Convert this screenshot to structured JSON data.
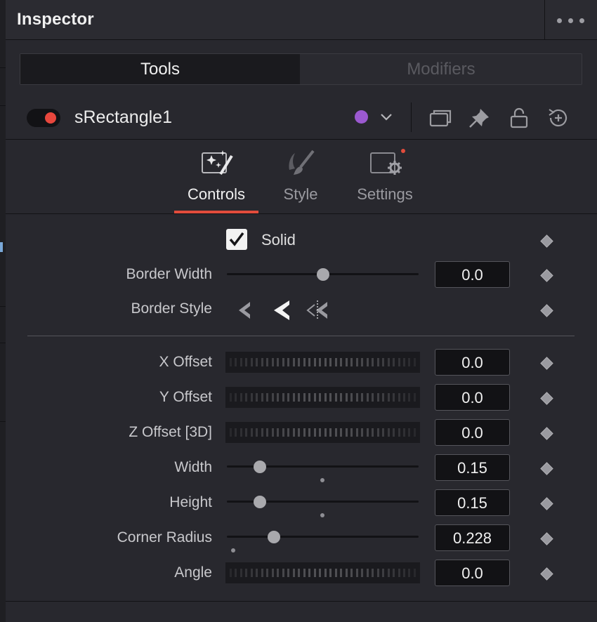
{
  "window": {
    "title": "Inspector",
    "more_icon": "ellipsis-icon"
  },
  "tabs": {
    "tools": "Tools",
    "modifiers": "Modifiers",
    "active": "Tools"
  },
  "node": {
    "name": "sRectangle1",
    "enabled": true,
    "toggle_color": "#e8473d",
    "color_swatch": "#9b59d0",
    "icons": [
      "copy-icon",
      "pin-icon",
      "lock-icon",
      "reset-icon"
    ]
  },
  "subtabs": [
    {
      "label": "Controls",
      "icon": "magic-wand-icon",
      "active": true
    },
    {
      "label": "Style",
      "icon": "brush-icon",
      "active": false
    },
    {
      "label": "Settings",
      "icon": "settings-gear-icon",
      "active": false
    }
  ],
  "accent_color": "#e24c3c",
  "controls": {
    "solid": {
      "label": "Solid",
      "checked": true
    },
    "border_width": {
      "label": "Border Width",
      "value": "0.0",
      "slider_level": 0.5
    },
    "border_style": {
      "label": "Border Style",
      "options": [
        "border-inside-icon",
        "border-center-icon",
        "border-outside-icon"
      ],
      "selected": 1
    },
    "x_offset": {
      "label": "X Offset",
      "value": "0.0"
    },
    "y_offset": {
      "label": "Y Offset",
      "value": "0.0"
    },
    "z_offset": {
      "label": "Z Offset [3D]",
      "value": "0.0"
    },
    "width": {
      "label": "Width",
      "value": "0.15",
      "slider_level": 0.18
    },
    "height": {
      "label": "Height",
      "value": "0.15",
      "slider_level": 0.18
    },
    "corner_radius": {
      "label": "Corner Radius",
      "value": "0.228",
      "slider_level": 0.25
    },
    "angle": {
      "label": "Angle",
      "value": "0.0"
    }
  }
}
